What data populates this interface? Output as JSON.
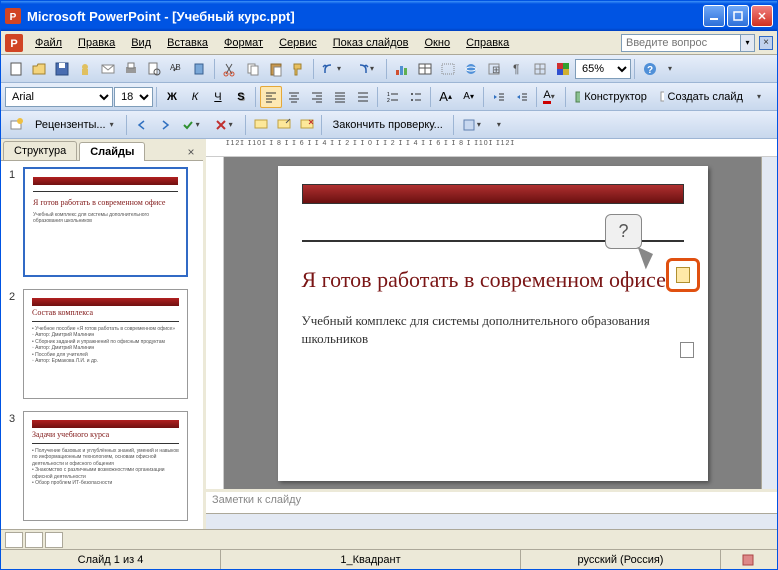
{
  "window": {
    "title": "Microsoft PowerPoint - [Учебный курс.ppt]"
  },
  "menu": {
    "file": "Файл",
    "edit": "Правка",
    "view": "Вид",
    "insert": "Вставка",
    "format": "Формат",
    "tools": "Сервис",
    "slideshow": "Показ слайдов",
    "window": "Окно",
    "help": "Справка"
  },
  "question_placeholder": "Введите вопрос",
  "toolbar2": {
    "font": "Arial",
    "size": "18",
    "designer": "Конструктор",
    "new_slide": "Создать слайд"
  },
  "toolbar1": {
    "zoom": "65%"
  },
  "toolbar3": {
    "reviewers": "Рецензенты...",
    "end_review": "Закончить проверку..."
  },
  "tabs": {
    "outline": "Структура",
    "slides": "Слайды"
  },
  "thumbnails": [
    {
      "num": "1",
      "title": "Я готов работать в современном офисе",
      "body": "Учебный комплекс для системы дополнительного образования школьников"
    },
    {
      "num": "2",
      "title": "Состав комплекса",
      "body": "• Учебное пособие «Я готов работать в современном офисе»\n  ◦ Автор: Дмитрий Малинин\n• Сборник заданий и упражнений по офисным продуктам\n  ◦ Автор: Дмитрий Малинин\n• Пособие для учителей\n  ◦ Автор: Ермакова Л.И. и др."
    },
    {
      "num": "3",
      "title": "Задачи учебного курса",
      "body": "• Получение базовых и углублённых знаний, умений и навыков по информационным технологиям, основам офисной деятельности и офисного общения\n• Знакомство с различными возможностями организации офисной деятельности\n• Обзор проблем ИТ-безопасности"
    }
  ],
  "slide": {
    "title": "Я готов работать в современном офисе",
    "subtitle": "Учебный комплекс для системы дополнительного образования школьников",
    "callout": "?"
  },
  "notes_placeholder": "Заметки к слайду",
  "status": {
    "slide": "Слайд 1 из 4",
    "template": "1_Квадрант",
    "lang": "русский (Россия)"
  }
}
